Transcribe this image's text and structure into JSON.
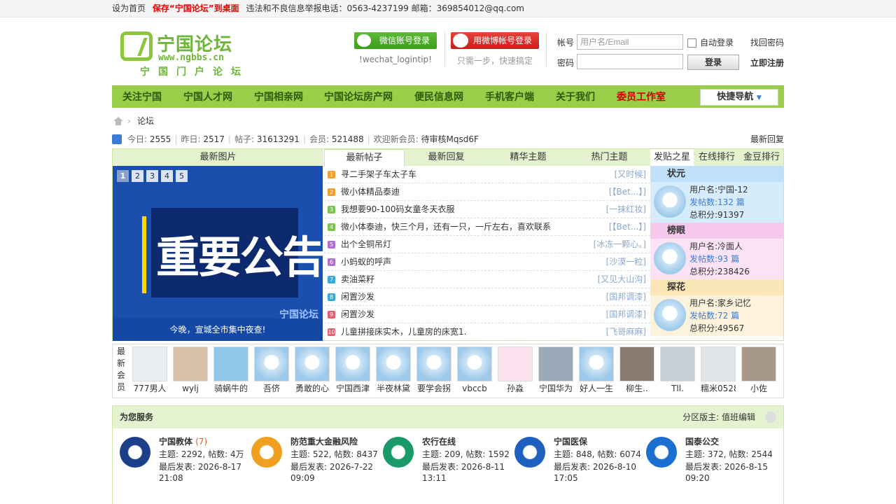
{
  "topbar": {
    "home": "设为首页",
    "save": "保存“宁国论坛”到桌面",
    "report": "违法和不良信息举报电话：0563-4237199 邮箱：369854012@qq.com"
  },
  "logo": {
    "title": "宁国论坛",
    "url": "www.ngbbs.cn",
    "slogan": "宁国门户论坛"
  },
  "login": {
    "wechat_label": "微信账号登录",
    "weibo_label": "用微博帐号登录",
    "wechat_hint": "!wechat_logintip!",
    "weibo_hint": "只需一步，快速搞定",
    "account_label": "帐号",
    "account_placeholder": "用户名/Email",
    "password_label": "密码",
    "auto_login": "自动登录",
    "submit": "登录",
    "forgot": "找回密码",
    "register": "立即注册"
  },
  "nav": {
    "items": [
      "关注宁国",
      "宁国人才网",
      "宁国相亲网",
      "宁国论坛房产网",
      "便民信息网",
      "手机客户端",
      "关于我们",
      "委员工作室"
    ],
    "quick": "快捷导航"
  },
  "breadcrumb": "论坛",
  "stats": {
    "today_label": "今日:",
    "today": "2555",
    "yesterday_label": "昨日:",
    "yesterday": "2517",
    "posts_label": "帖子:",
    "posts": "31613291",
    "members_label": "会员:",
    "members": "521488",
    "welcome_label": "欢迎新会员:",
    "welcome": "待审核Mqsd6F",
    "latest_reply": "最新回复"
  },
  "picture": {
    "heading": "最新图片",
    "pages": [
      "1",
      "2",
      "3",
      "4",
      "5"
    ],
    "image_text": "重要公告",
    "caption": "今晚，宣城全市集中夜查!",
    "watermark": "宁国论坛"
  },
  "tabs": [
    "最新帖子",
    "最新回复",
    "精华主题",
    "热门主题"
  ],
  "posts": [
    {
      "n": "1",
      "title": "寻二手架子车太子车",
      "author": "[又时候]",
      "color": "#f0a030"
    },
    {
      "n": "2",
      "title": "微小体精品泰迪",
      "author": "[【Bet...】]",
      "color": "#f0a030"
    },
    {
      "n": "3",
      "title": "我想要90-100码女童冬天衣服",
      "author": "[一抹红妆]",
      "color": "#7cc250"
    },
    {
      "n": "4",
      "title": "微小体泰迪，快三个月，还有一只，一斤左右，喜欢联系",
      "author": "[【Bet...】]",
      "color": "#7cc250"
    },
    {
      "n": "5",
      "title": "出个全铜吊灯",
      "author": "[冰冻一颗心。]",
      "color": "#b070d0"
    },
    {
      "n": "6",
      "title": "小蚂蚁的呼声",
      "author": "[沙漠一粒]",
      "color": "#b070d0"
    },
    {
      "n": "7",
      "title": "卖油菜籽",
      "author": "[又见大山沟]",
      "color": "#3aa8d8"
    },
    {
      "n": "8",
      "title": "闲置沙发",
      "author": "[国邦调漆]",
      "color": "#3aa8d8"
    },
    {
      "n": "9",
      "title": "闲置沙发",
      "author": "[国邦调漆]",
      "color": "#e06070"
    },
    {
      "n": "10",
      "title": "儿童拼接床实木，儿童房的床宽1.",
      "author": "[飞哥麻麻]",
      "color": "#e06070"
    }
  ],
  "stars": {
    "tabs": [
      "发贴之星",
      "在线排行",
      "金豆排行"
    ],
    "user_label": "用户名:",
    "posts_label": "发帖数:",
    "score_label": "总积分:",
    "unit": "篇",
    "items": [
      {
        "rank": "状元",
        "user": "宁国-12",
        "posts": "132",
        "score": "91397",
        "bg": "#d7ecfb",
        "hd": "#bfe0f8",
        "gem": "#3a7bd5"
      },
      {
        "rank": "榜眼",
        "user": "冷面人",
        "posts": "93",
        "score": "238426",
        "bg": "#fbe3f5",
        "hd": "#f5c8ec",
        "gem": "#d03070"
      },
      {
        "rank": "探花",
        "user": "家乡记忆",
        "posts": "72",
        "score": "49567",
        "bg": "#fdf3dc",
        "hd": "#fbe6b8",
        "gem": "#e8a020"
      }
    ]
  },
  "members": {
    "label": "最新会员",
    "list": [
      "777男人",
      "wylj",
      "骑蜗牛的",
      "吾侪",
      "勇敢的心",
      "宁国西津",
      "半夜林黛",
      "要学会拐",
      "vbccb",
      "孙淼",
      "宁国华为",
      "好人一生",
      "柳生..",
      "Tll.",
      "糯米0528",
      "小佐"
    ]
  },
  "service": {
    "title": "为您服务",
    "moderator_label": "分区版主:",
    "moderator": "值班编辑",
    "topics_label": "主题:",
    "posts_label": "帖数:",
    "last_label": "最后发表:",
    "forums": [
      {
        "name": "宁国教体",
        "count": "(7)",
        "topics": "2292",
        "posts": "4万",
        "date": "2026-8-17",
        "time": "21:08",
        "color": "#1d3f8a"
      },
      {
        "name": "防范重大金融风险",
        "count": "",
        "topics": "522",
        "posts": "8437",
        "date": "2026-7-22",
        "time": "09:09",
        "color": "#f0a020"
      },
      {
        "name": "农行在线",
        "count": "",
        "topics": "209",
        "posts": "1592",
        "date": "2026-8-11",
        "time": "13:11",
        "color": "#1a9a6a"
      },
      {
        "name": "宁国医保",
        "count": "",
        "topics": "848",
        "posts": "6074",
        "date": "2026-8-10",
        "time": "17:05",
        "color": "#1f5fc0"
      },
      {
        "name": "国泰公交",
        "count": "",
        "topics": "372",
        "posts": "2544",
        "date": "2026-8-15",
        "time": "09:20",
        "color": "#1a6fd0"
      }
    ]
  }
}
